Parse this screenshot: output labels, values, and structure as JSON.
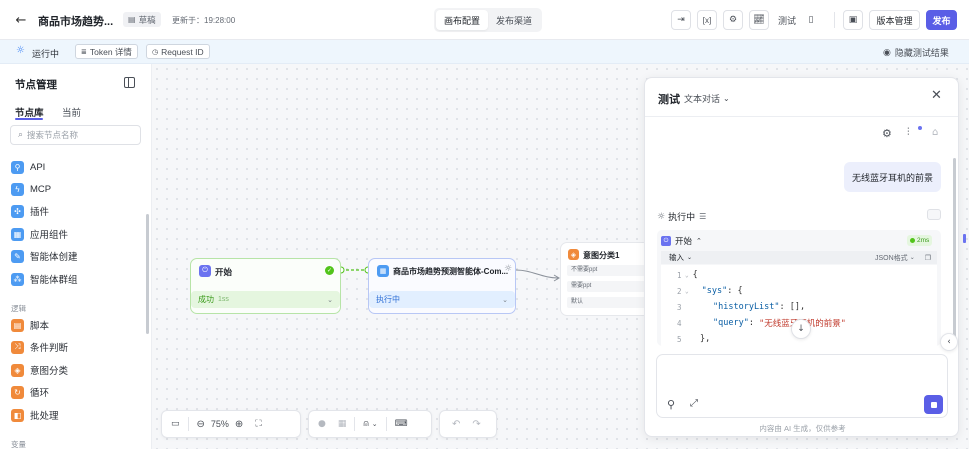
{
  "header": {
    "back_icon": "arrow-left-icon",
    "app_title": "商品市场趋势...",
    "draft_badge": "草稿",
    "updated_at": "更新于：19:28:00",
    "tabs": [
      "画布配置",
      "发布渠道"
    ],
    "test_label": "测试",
    "version_label": "版本管理",
    "publish_label": "发布",
    "accent_color": "#5a5ee6"
  },
  "statusbar": {
    "running": "运行中",
    "token_detail": "Token 详情",
    "request_id": "Request ID",
    "hide_results": "隐藏测试结果"
  },
  "sidebar": {
    "title": "节点管理",
    "tabs": [
      "节点库",
      "当前"
    ],
    "search_placeholder": "搜索节点名称",
    "items": [
      {
        "label": "API",
        "icon": "link-icon"
      },
      {
        "label": "MCP",
        "icon": "plug-icon"
      },
      {
        "label": "插件",
        "icon": "puzzle-icon"
      },
      {
        "label": "应用组件",
        "icon": "component-icon"
      },
      {
        "label": "智能体创建",
        "icon": "agent-create-icon"
      },
      {
        "label": "智能体群组",
        "icon": "agent-group-icon"
      }
    ],
    "logic_section": "逻辑",
    "logic_items": [
      {
        "label": "脚本",
        "icon": "script-icon"
      },
      {
        "label": "条件判断",
        "icon": "branch-icon"
      },
      {
        "label": "意图分类",
        "icon": "intent-icon"
      },
      {
        "label": "循环",
        "icon": "loop-icon"
      },
      {
        "label": "批处理",
        "icon": "batch-icon"
      }
    ],
    "variable_section": "变量"
  },
  "canvas": {
    "start_node": {
      "title": "开始",
      "status": "成功",
      "duration": "1ss"
    },
    "agent_node": {
      "title": "商品市场趋势预测智能体-Com...",
      "status": "执行中"
    },
    "intent_node": {
      "title": "意图分类1",
      "options": [
        "不需要ppt",
        "需要ppt",
        "默认"
      ]
    },
    "zoom": "75%"
  },
  "panel": {
    "title": "测试",
    "mode": "文本对话",
    "user_message": "无线蓝牙耳机的前景",
    "executing": "执行中",
    "start_label": "开始",
    "start_duration": "2ms",
    "input_label": "输入",
    "format_label": "JSON格式",
    "code": {
      "lines": [
        "1",
        "2",
        "3",
        "4",
        "5"
      ],
      "sys_key": "\"sys\"",
      "history_key": "\"historyList\"",
      "query_key": "\"query\"",
      "query_value": "\"无线蓝牙耳机的前景\""
    },
    "footer_note": "内容由 AI 生成，仅供参考"
  }
}
